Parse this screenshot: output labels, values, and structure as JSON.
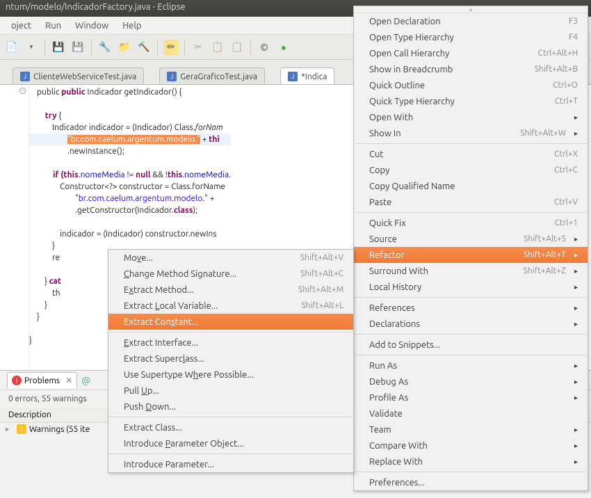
{
  "title": "ntum/modelo/IndicadorFactory.java - Eclipse",
  "menu": {
    "items": [
      "oject",
      "Run",
      "Window",
      "Help"
    ]
  },
  "tabs": {
    "items": [
      {
        "label": "ClienteWebServiceTest.java",
        "active": false
      },
      {
        "label": "GeraGraficoTest.java",
        "active": false
      },
      {
        "label": "*Indica",
        "active": true
      }
    ]
  },
  "code": {
    "l1_pre": "    public ",
    "l1_ret": "Indicador ",
    "l1_post": "getIndicador() {",
    "l2_pre": "        try",
    "l2_post": " {",
    "l3_pre": "            Indicador indicador = (Indicador) Class.",
    "l3_m": "forNam",
    "l4_pre": "                    ",
    "l4_str": "\"br.com.caelum.argentum.modelo.\"",
    "l4_plus": " + ",
    "l4_thi": "thi",
    "l5": "                    .newInstance();",
    "l6_if": "            if ",
    "l6_th": "(this",
    "l6_nm": ".nomeMedia != ",
    "l6_null": "null",
    "l6_post": " && !",
    "l6_th2": "this",
    "l6_tail": ".nomeMedia.",
    "l7": "                Constructor<?> constructor = Class.forName",
    "l8_pre": "                        ",
    "l8_str": "\"br.com.caelum.argentum.modelo.\"",
    "l8_post": " +",
    "l9_pre": "                        .getConstructor(Indicador.",
    "l9_cls": "class",
    "l9_post": ");",
    "l10": "                indicador = (Indicador) constructor.newIns",
    "l11": "            }",
    "l12": "            re",
    "l13_pre": "        } ",
    "l13_cat": "cat",
    "l14": "            th",
    "l15": "        }",
    "l16": "    }",
    "l17": "}"
  },
  "bottom": {
    "problems_tab": "Problems",
    "status": "0 errors, 55 warnings",
    "header": "Description",
    "warnings": "Warnings (55 ite"
  },
  "main_ctx": {
    "items": [
      {
        "label": "Open Declaration",
        "shortcut": "F3"
      },
      {
        "label": "Open Type Hierarchy",
        "shortcut": "F4"
      },
      {
        "label": "Open Call Hierarchy",
        "shortcut": "Ctrl+Alt+H"
      },
      {
        "label": "Show in Breadcrumb",
        "shortcut": "Shift+Alt+B"
      },
      {
        "label": "Quick Outline",
        "shortcut": "Ctrl+O"
      },
      {
        "label": "Quick Type Hierarchy",
        "shortcut": "Ctrl+T"
      },
      {
        "label": "Open With",
        "shortcut": "",
        "sub": true
      },
      {
        "label": "Show In",
        "shortcut": "Shift+Alt+W",
        "sub": true
      }
    ],
    "items2": [
      {
        "label": "Cut",
        "shortcut": "Ctrl+X"
      },
      {
        "label": "Copy",
        "shortcut": "Ctrl+C"
      },
      {
        "label": "Copy Qualified Name",
        "shortcut": ""
      },
      {
        "label": "Paste",
        "shortcut": "Ctrl+V"
      }
    ],
    "items3": [
      {
        "label": "Quick Fix",
        "shortcut": "Ctrl+1"
      },
      {
        "label": "Source",
        "shortcut": "Shift+Alt+S",
        "sub": true
      },
      {
        "label": "Refactor",
        "shortcut": "Shift+Alt+T",
        "sub": true,
        "highlighted": true
      },
      {
        "label": "Surround With",
        "shortcut": "Shift+Alt+Z",
        "sub": true
      },
      {
        "label": "Local History",
        "shortcut": "",
        "sub": true
      }
    ],
    "items4": [
      {
        "label": "References",
        "sub": true
      },
      {
        "label": "Declarations",
        "sub": true
      }
    ],
    "items5": [
      {
        "label": "Add to Snippets..."
      }
    ],
    "items6": [
      {
        "label": "Run As",
        "sub": true
      },
      {
        "label": "Debug As",
        "sub": true
      },
      {
        "label": "Profile As",
        "sub": true
      },
      {
        "label": "Validate"
      },
      {
        "label": "Team",
        "sub": true
      },
      {
        "label": "Compare With",
        "sub": true
      },
      {
        "label": "Replace With",
        "sub": true
      }
    ],
    "items7": [
      {
        "label": "Preferences..."
      }
    ]
  },
  "sub_ctx": {
    "items": [
      {
        "label_html": "Move...",
        "ul_idx": 2,
        "shortcut": "Shift+Alt+V"
      },
      {
        "label_html": "Change Method Signature...",
        "ul_idx": 0,
        "shortcut": "Shift+Alt+C"
      },
      {
        "label_html": "Extract Method...",
        "ul_idx": 1,
        "shortcut": "Shift+Alt+M"
      },
      {
        "label_html": "Extract Local Variable...",
        "ul_idx": 8,
        "shortcut": "Shift+Alt+L"
      },
      {
        "label_html": "Extract Constant...",
        "ul_idx": 11,
        "highlighted": true
      }
    ],
    "items2": [
      {
        "label_html": "Extract Interface...",
        "ul_idx": 0
      },
      {
        "label_html": "Extract Superclass...",
        "ul_idx": 14
      },
      {
        "label_html": "Use Supertype Where Possible...",
        "ul_idx": 15
      },
      {
        "label_html": "Pull Up...",
        "ul_idx": 5
      },
      {
        "label_html": "Push Down...",
        "ul_idx": 5
      }
    ],
    "items3": [
      {
        "label_html": "Extract Class...",
        "ul_idx": -1
      },
      {
        "label_html": "Introduce Parameter Object...",
        "ul_idx": 10
      }
    ],
    "items4": [
      {
        "label_html": "Introduce Parameter...",
        "ul_idx": -1
      }
    ]
  }
}
